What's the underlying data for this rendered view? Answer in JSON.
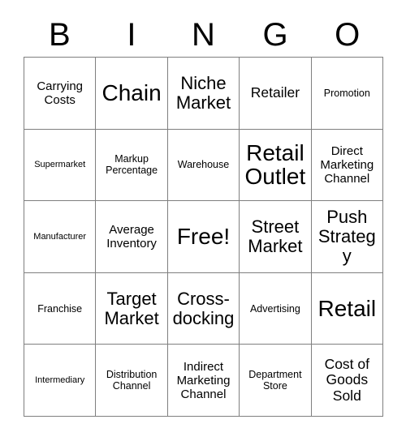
{
  "card": {
    "title": "BINGO",
    "header_letters": [
      "B",
      "I",
      "N",
      "G",
      "O"
    ],
    "colors": {
      "background": "#ffffff",
      "grid_line": "#7f7f7f",
      "text": "#000000"
    },
    "grid": {
      "rows": 5,
      "columns": 5,
      "free_space": {
        "row": 3,
        "column": 3,
        "label": "Free!"
      }
    },
    "cells": [
      [
        {
          "label": "Carrying Costs",
          "size": "md"
        },
        {
          "label": "Chain",
          "size": "xxl"
        },
        {
          "label": "Niche Market",
          "size": "xl"
        },
        {
          "label": "Retailer",
          "size": "lg"
        },
        {
          "label": "Promotion",
          "size": "sm"
        }
      ],
      [
        {
          "label": "Supermarket",
          "size": "xs"
        },
        {
          "label": "Markup Percentage",
          "size": "sm"
        },
        {
          "label": "Warehouse",
          "size": "sm"
        },
        {
          "label": "Retail Outlet",
          "size": "xxl"
        },
        {
          "label": "Direct Marketing Channel",
          "size": "md"
        }
      ],
      [
        {
          "label": "Manufacturer",
          "size": "xs"
        },
        {
          "label": "Average Inventory",
          "size": "md"
        },
        {
          "label": "Free!",
          "size": "xxl"
        },
        {
          "label": "Street Market",
          "size": "xl"
        },
        {
          "label": "Push Strategy",
          "size": "xl"
        }
      ],
      [
        {
          "label": "Franchise",
          "size": "sm"
        },
        {
          "label": "Target Market",
          "size": "xl"
        },
        {
          "label": "Cross-docking",
          "size": "xl"
        },
        {
          "label": "Advertising",
          "size": "sm"
        },
        {
          "label": "Retail",
          "size": "xxl"
        }
      ],
      [
        {
          "label": "Intermediary",
          "size": "xs"
        },
        {
          "label": "Distribution Channel",
          "size": "sm"
        },
        {
          "label": "Indirect Marketing Channel",
          "size": "md"
        },
        {
          "label": "Department Store",
          "size": "sm"
        },
        {
          "label": "Cost of Goods Sold",
          "size": "lg"
        }
      ]
    ]
  }
}
